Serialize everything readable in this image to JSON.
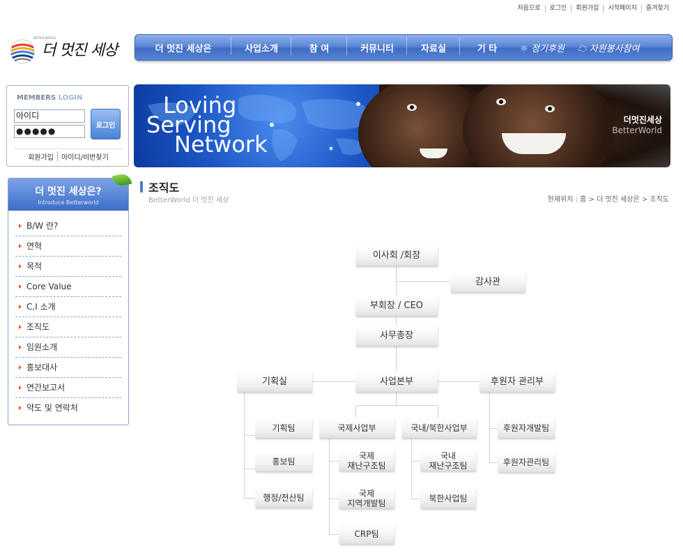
{
  "util_nav": [
    "처음으로",
    "로그인",
    "회원가입",
    "시작페이지",
    "즐겨찾기"
  ],
  "logo": {
    "text": "더 멋진 세상",
    "sub": "BETTER WORLD"
  },
  "gnb": [
    "더 멋진 세상은",
    "사업소개",
    "참 여",
    "커뮤니티",
    "자료실",
    "기 타",
    "정기후원",
    "자원봉사참여"
  ],
  "login": {
    "title_prefix": "MEMBERS",
    "title_suffix": "LOGIN",
    "id_value": "아이디",
    "pw_value": "●●●●●",
    "button": "로그인",
    "links": [
      "회원가입",
      "아이디/비번찾기"
    ]
  },
  "banner": {
    "slogan": [
      "Loving",
      "Serving",
      "Network"
    ],
    "brand_ko": "더멋진세상",
    "brand_en": "BetterWorld"
  },
  "side_menu": {
    "title": "더 멋진 세상은?",
    "subtitle": "Introduce Betterworld",
    "items": [
      "B/W 란?",
      "연혁",
      "목적",
      "Core Value",
      "C,I 소개",
      "조직도",
      "임원소개",
      "홍보대사",
      "연간보고서",
      "약도 및 연락처"
    ]
  },
  "content": {
    "title": "조직도",
    "subtitle": "BetterWorld 더 멋진 세상",
    "location": "현재위치 : 홈 > 더  멋진 세상은 > 조직도"
  },
  "org": {
    "board": "이사회 /회장",
    "auditor": "감사관",
    "vice": "부회장 / CEO",
    "secretary": "사무총장",
    "planning": "기획실",
    "business": "사업본부",
    "donor": "후원자 관리부",
    "planning_team": "기획팀",
    "pr_team": "홍보팀",
    "admin_team": "행정/전산팀",
    "intl": "국제사업부",
    "domestic": "국내/북한사업부",
    "intl_relief": "국제\n재난구조팀",
    "intl_dev": "국제\n지역개발팀",
    "crp": "CRP팀",
    "dom_relief": "국내\n재난구조팀",
    "nk_team": "북한사업팀",
    "donor_dev": "후원자개발팀",
    "donor_mgmt": "후원자관리팀"
  }
}
